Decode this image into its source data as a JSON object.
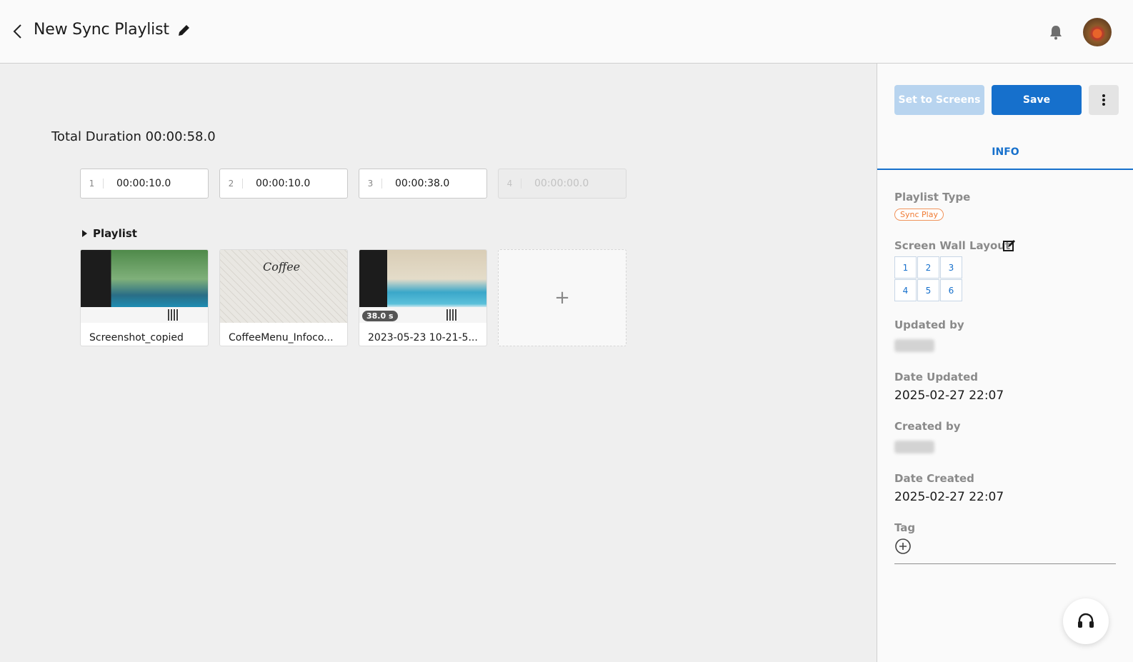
{
  "header": {
    "title": "New Sync Playlist"
  },
  "main": {
    "total_duration": "Total Duration 00:00:58.0",
    "durations": [
      {
        "index": "1",
        "value": "00:00:10.0",
        "enabled": true
      },
      {
        "index": "2",
        "value": "00:00:10.0",
        "enabled": true
      },
      {
        "index": "3",
        "value": "00:00:38.0",
        "enabled": true
      },
      {
        "index": "4",
        "value": "00:00:00.0",
        "enabled": false
      }
    ],
    "playlist_label": "Playlist",
    "items": [
      {
        "name": "Screenshot_copied"
      },
      {
        "name": "CoffeeMenu_Infoco...",
        "thumb_text": "Coffee"
      },
      {
        "name": "2023-05-23 10-21-5...",
        "badge": "38.0 s"
      }
    ],
    "add_symbol": "+"
  },
  "panel": {
    "set_to_screens": "Set to Screens",
    "save": "Save",
    "tab_info": "INFO",
    "playlist_type_label": "Playlist Type",
    "playlist_type_value": "Sync Play",
    "screen_wall_layout_label": "Screen Wall Layout",
    "layout_cells": [
      "1",
      "2",
      "3",
      "4",
      "5",
      "6"
    ],
    "updated_by_label": "Updated by",
    "date_updated_label": "Date Updated",
    "date_updated_value": "2025-02-27 22:07",
    "created_by_label": "Created by",
    "date_created_label": "Date Created",
    "date_created_value": "2025-02-27 22:07",
    "tag_label": "Tag"
  },
  "colors": {
    "accent": "#1670cc",
    "sync_play_badge": "#f07a32"
  },
  "icons": [
    "back-arrow-icon",
    "pencil-icon",
    "bell-icon",
    "more-vertical-icon",
    "edit-square-icon",
    "plus-circle-icon",
    "headset-icon"
  ]
}
